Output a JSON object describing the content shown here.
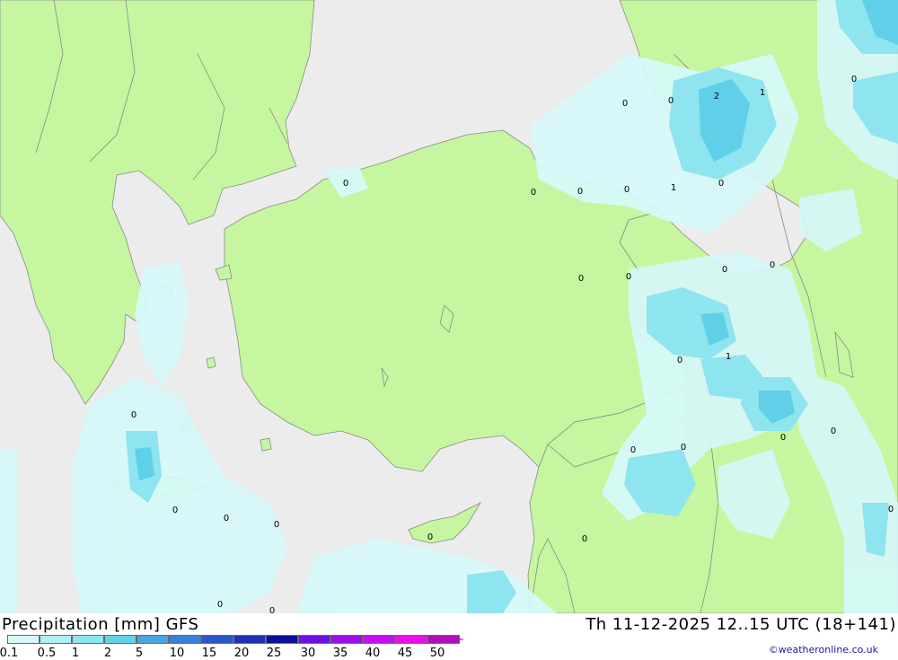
{
  "title": "Precipitation [mm] GFS",
  "datetime": "Th 11-12-2025 12..15 UTC (18+141)",
  "credit": "©weatheronline.co.uk",
  "colors": {
    "sea": "#ececec",
    "land": "#c6f69f",
    "border": "#8a8a8a",
    "precip_0_1": "#d6f8fa",
    "precip_0_5": "#a8eef4",
    "precip_1": "#80e2ee",
    "precip_2": "#5fd0e8"
  },
  "legend": {
    "ticks": [
      "0.1",
      "0.5",
      "1",
      "2",
      "5",
      "10",
      "15",
      "20",
      "25",
      "30",
      "35",
      "40",
      "45",
      "50"
    ],
    "colors": [
      "#d6f8fa",
      "#b0eff5",
      "#8ee4ef",
      "#62d2e6",
      "#4aa6dc",
      "#3a7fd8",
      "#2a56c8",
      "#1c32b0",
      "#0d0f98",
      "#6a10e0",
      "#9a10e8",
      "#c410f0",
      "#e810e8",
      "#b010b8"
    ]
  },
  "values": [
    "0",
    "0",
    "0",
    "2",
    "1",
    "0",
    "0",
    "0",
    "1",
    "0",
    "0",
    "0",
    "0",
    "0",
    "0",
    "0",
    "1",
    "0",
    "0",
    "0",
    "0",
    "0",
    "0",
    "0",
    "0",
    "0",
    "0",
    "0",
    "0",
    "0"
  ]
}
